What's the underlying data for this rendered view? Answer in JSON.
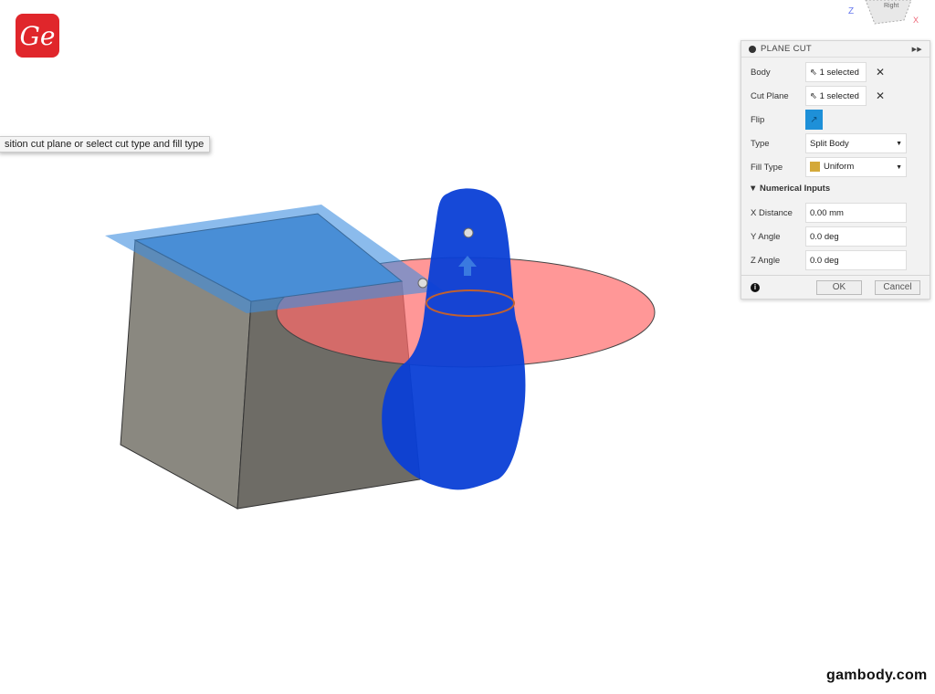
{
  "logo": {
    "text": "Ge"
  },
  "tooltip": "sition cut plane or select cut type and fill type",
  "viewcube": {
    "face": "Right",
    "axis_z": "Z",
    "axis_x": "X"
  },
  "panel": {
    "title": "PLANE CUT",
    "body": {
      "label": "Body",
      "value": "1 selected"
    },
    "cut_plane": {
      "label": "Cut Plane",
      "value": "1 selected"
    },
    "flip": {
      "label": "Flip",
      "color": "#1e90d8"
    },
    "type": {
      "label": "Type",
      "value": "Split Body"
    },
    "fill_type": {
      "label": "Fill Type",
      "value": "Uniform"
    },
    "section": "Numerical Inputs",
    "x_distance": {
      "label": "X Distance",
      "value": "0.00 mm"
    },
    "y_angle": {
      "label": "Y Angle",
      "value": "0.0 deg"
    },
    "z_angle": {
      "label": "Z Angle",
      "value": "0.0 deg"
    },
    "ok": "OK",
    "cancel": "Cancel"
  },
  "watermark": "gambody.com"
}
